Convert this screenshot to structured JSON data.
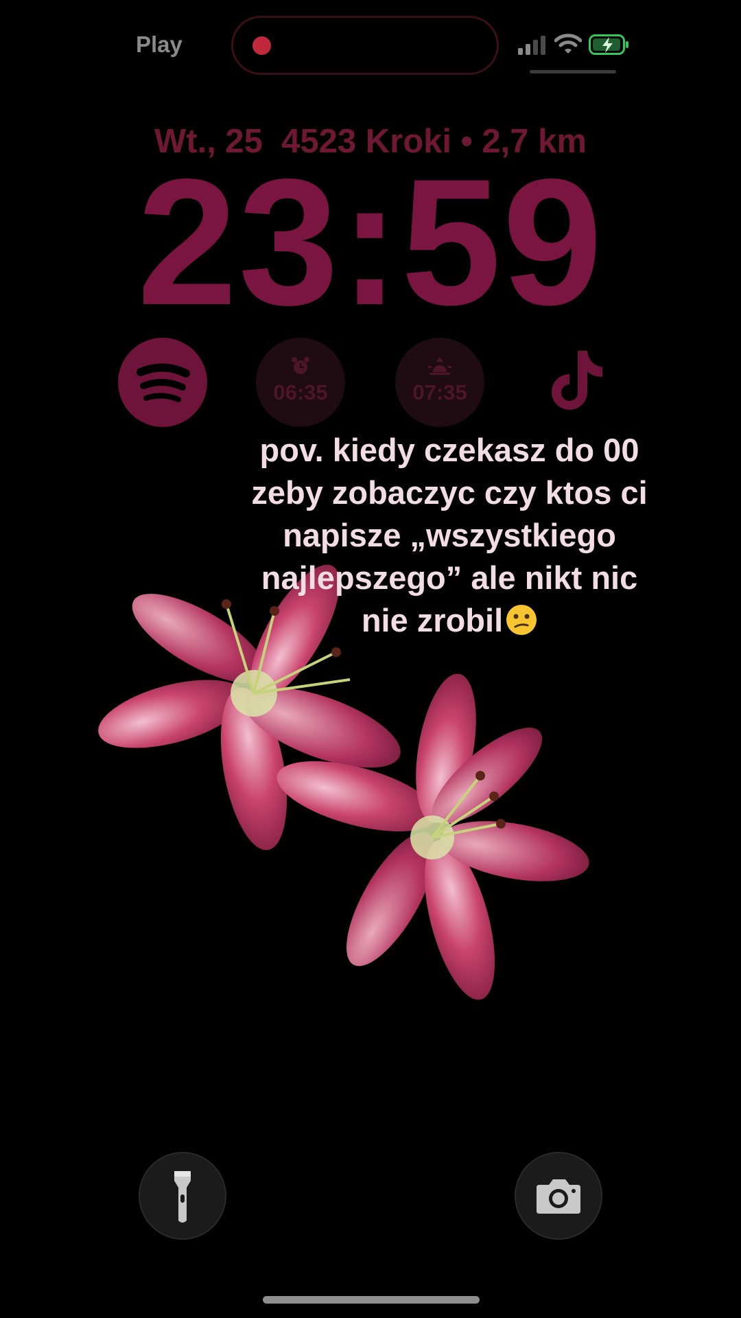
{
  "status_bar": {
    "carrier": "Play",
    "recording_color": "#c0283b",
    "battery_color": "#34c759"
  },
  "lock_screen": {
    "date": "Wt., 25",
    "steps_info": "4523 Kroki • 2,7 km",
    "time": "23:59",
    "accent_color": "#7a1440"
  },
  "widgets": {
    "spotify": {
      "icon": "spotify-icon"
    },
    "alarm": {
      "icon": "alarm-clock-icon",
      "time": "06:35"
    },
    "sunrise": {
      "icon": "sunrise-icon",
      "time": "07:35"
    },
    "tiktok": {
      "icon": "tiktok-icon"
    }
  },
  "caption": {
    "lines": [
      "pov. kiedy czekasz do 00",
      "zeby zobaczyc czy ktos ci",
      "napisze „wszystkiego",
      "najlepszego” ale nikt nic",
      "nie zrobil"
    ],
    "emoji": "confused-face-emoji"
  },
  "bottom_controls": {
    "left": "flashlight-icon",
    "right": "camera-icon"
  }
}
